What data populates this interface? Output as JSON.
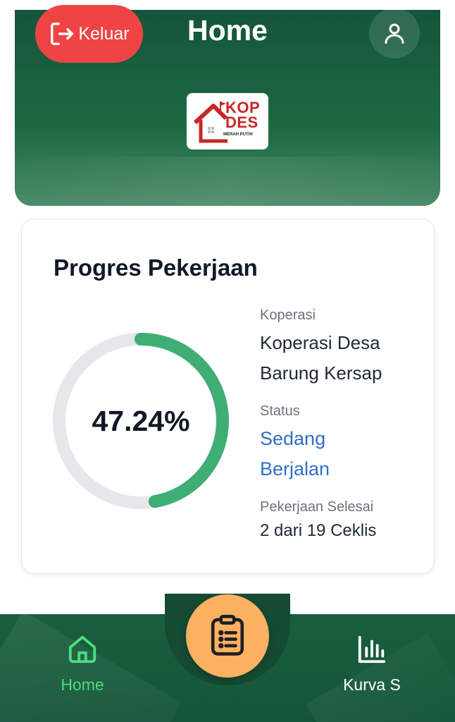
{
  "header": {
    "title": "Home",
    "logout_label": "Keluar",
    "logo": {
      "line1": "KOP",
      "line2": "DES",
      "sub": "MERAH PUTIH"
    }
  },
  "progress_card": {
    "title": "Progres Pekerjaan",
    "percent": 47.24,
    "percent_label": "47.24%",
    "ring_color": "#3fae74",
    "track_color": "#e5e7eb",
    "koperasi_label": "Koperasi",
    "koperasi_line1": "Koperasi Desa",
    "koperasi_line2": "Barung Kersap",
    "status_label": "Status",
    "status_line1": "Sedang",
    "status_line2": "Berjalan",
    "status_color": "#2f6fc9",
    "done_label": "Pekerjaan Selesai",
    "done_value": "2 dari 19 Ceklis"
  },
  "bottom_nav": {
    "home_label": "Home",
    "kurva_label": "Kurva S",
    "active": "Home",
    "fab_icon": "clipboard-list-icon",
    "accent": "#4ade80",
    "fab_color": "#fbb162"
  }
}
